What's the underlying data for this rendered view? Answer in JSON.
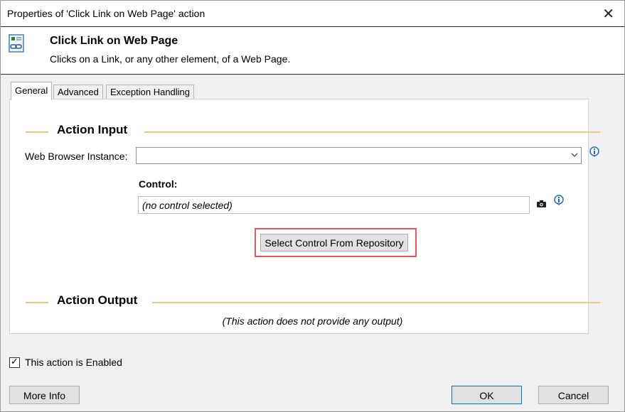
{
  "window": {
    "title": "Properties of 'Click Link on Web Page' action",
    "close_glyph": "✕"
  },
  "header": {
    "title": "Click Link on Web Page",
    "description": "Clicks on a Link, or any other element, of a Web Page."
  },
  "tabs": [
    {
      "label": "General",
      "active": true
    },
    {
      "label": "Advanced",
      "active": false
    },
    {
      "label": "Exception Handling",
      "active": false
    }
  ],
  "action_input": {
    "title": "Action Input",
    "browser_label": "Web Browser Instance:",
    "browser_value": "",
    "control_label": "Control:",
    "control_value": "(no control selected)",
    "select_button": "Select Control From Repository"
  },
  "action_output": {
    "title": "Action Output",
    "message": "(This action does not provide any output)"
  },
  "footer": {
    "enabled_label": "This action is Enabled",
    "enabled": true,
    "more_info": "More Info",
    "ok": "OK",
    "cancel": "Cancel"
  },
  "colors": {
    "section_line": "#f2c58d",
    "highlight": "#e05a60",
    "info_blue": "#1e6fc9"
  }
}
